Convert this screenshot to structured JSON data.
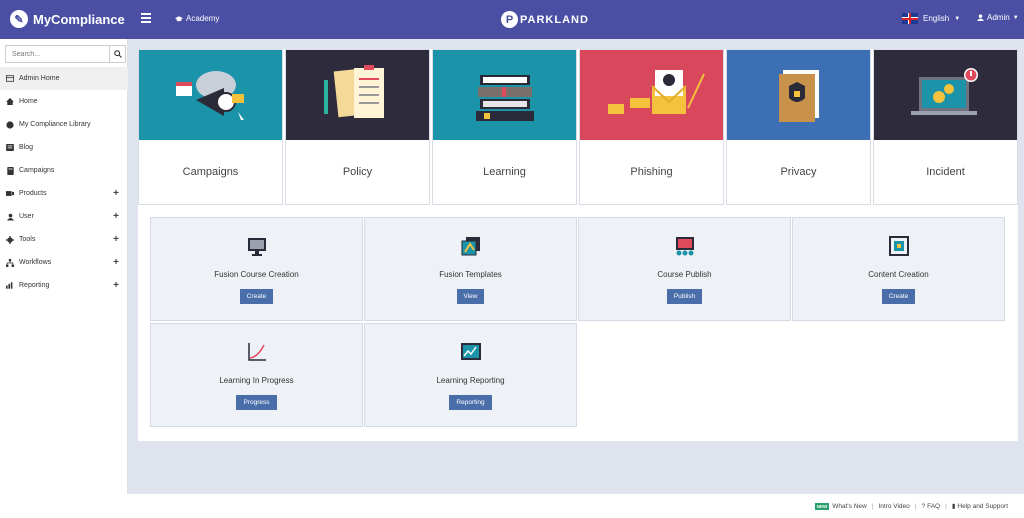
{
  "header": {
    "brand": "MyCompliance",
    "academy": "Academy",
    "center_logo": "PARKLAND",
    "language": "English",
    "user": "Admin"
  },
  "sidebar": {
    "search_placeholder": "Search...",
    "items": [
      {
        "label": "Admin Home",
        "icon": "dashboard-icon",
        "active": true,
        "expandable": false
      },
      {
        "label": "Home",
        "icon": "home-icon",
        "active": false,
        "expandable": false
      },
      {
        "label": "My Compliance Library",
        "icon": "globe-icon",
        "active": false,
        "expandable": false
      },
      {
        "label": "Blog",
        "icon": "blog-icon",
        "active": false,
        "expandable": false
      },
      {
        "label": "Campaigns",
        "icon": "campaign-icon",
        "active": false,
        "expandable": false
      },
      {
        "label": "Products",
        "icon": "products-icon",
        "active": false,
        "expandable": true
      },
      {
        "label": "User",
        "icon": "user-icon",
        "active": false,
        "expandable": true
      },
      {
        "label": "Tools",
        "icon": "tools-icon",
        "active": false,
        "expandable": true
      },
      {
        "label": "Workflows",
        "icon": "workflow-icon",
        "active": false,
        "expandable": true
      },
      {
        "label": "Reporting",
        "icon": "chart-icon",
        "active": false,
        "expandable": true
      }
    ]
  },
  "categories": [
    {
      "label": "Campaigns",
      "color": "#1b93a8",
      "icon": "megaphone-icon"
    },
    {
      "label": "Policy",
      "color": "#2e2c3c",
      "icon": "clipboard-icon"
    },
    {
      "label": "Learning",
      "color": "#1b93a8",
      "icon": "books-icon"
    },
    {
      "label": "Phishing",
      "color": "#d9475d",
      "icon": "envelope-skull-icon"
    },
    {
      "label": "Privacy",
      "color": "#3d6fb5",
      "icon": "folder-lock-icon"
    },
    {
      "label": "Incident",
      "color": "#2e2c3c",
      "icon": "laptop-gears-icon"
    }
  ],
  "tiles": [
    {
      "title": "Fusion Course Creation",
      "button": "Create",
      "icon": "course-creation-icon"
    },
    {
      "title": "Fusion Templates",
      "button": "View",
      "icon": "templates-icon"
    },
    {
      "title": "Course Publish",
      "button": "Publish",
      "icon": "publish-icon"
    },
    {
      "title": "Content Creation",
      "button": "Create",
      "icon": "content-creation-icon"
    },
    {
      "title": "Learning In Progress",
      "button": "Progress",
      "icon": "progress-chart-icon"
    },
    {
      "title": "Learning Reporting",
      "button": "Reporting",
      "icon": "reporting-icon"
    }
  ],
  "footer": {
    "badge": "NEW",
    "whats_new": "What's New",
    "intro_video": "Intro Video",
    "faq": "FAQ",
    "help": "Help and Support"
  }
}
